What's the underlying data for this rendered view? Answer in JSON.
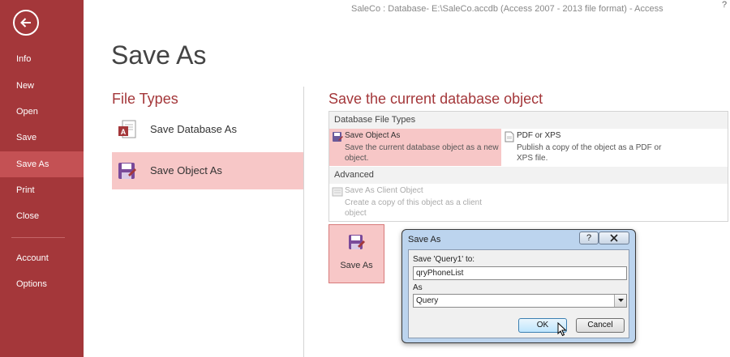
{
  "window": {
    "title": "SaleCo : Database- E:\\SaleCo.accdb (Access 2007 - 2013 file format) - Access",
    "help": "?"
  },
  "sidebar": {
    "items": [
      {
        "label": "Info"
      },
      {
        "label": "New"
      },
      {
        "label": "Open"
      },
      {
        "label": "Save"
      },
      {
        "label": "Save As",
        "active": true
      },
      {
        "label": "Print"
      },
      {
        "label": "Close"
      },
      {
        "label": "Account"
      },
      {
        "label": "Options"
      }
    ]
  },
  "page": {
    "title": "Save As"
  },
  "file_types": {
    "heading": "File Types",
    "items": [
      {
        "label": "Save Database As",
        "icon": "access-database-icon"
      },
      {
        "label": "Save Object As",
        "icon": "save-object-icon",
        "selected": true
      }
    ]
  },
  "save_panel": {
    "heading": "Save the current database object",
    "database_file_types": {
      "header": "Database File Types",
      "save_object_as": {
        "title": "Save Object As",
        "desc1": "Save the current database object as a new",
        "desc2": "object."
      },
      "pdf_xps": {
        "title": "PDF or XPS",
        "desc1": "Publish a copy of the object as a PDF or",
        "desc2": "XPS file."
      }
    },
    "advanced": {
      "header": "Advanced",
      "client_object": {
        "title": "Save As Client Object",
        "desc1": "Create a copy of this object as a client",
        "desc2": "object"
      }
    },
    "save_as_button": "Save As"
  },
  "dialog": {
    "title": "Save As",
    "help_label": "?",
    "save_to_label": "Save 'Query1' to:",
    "name_value": "qryPhoneList",
    "as_label": "As",
    "type_value": "Query",
    "ok_label": "OK",
    "cancel_label": "Cancel"
  },
  "colors": {
    "sidebar": "#a4373a",
    "sidebar_active": "#c45154",
    "accent_text": "#a4373a",
    "selection": "#f7c7c7"
  }
}
